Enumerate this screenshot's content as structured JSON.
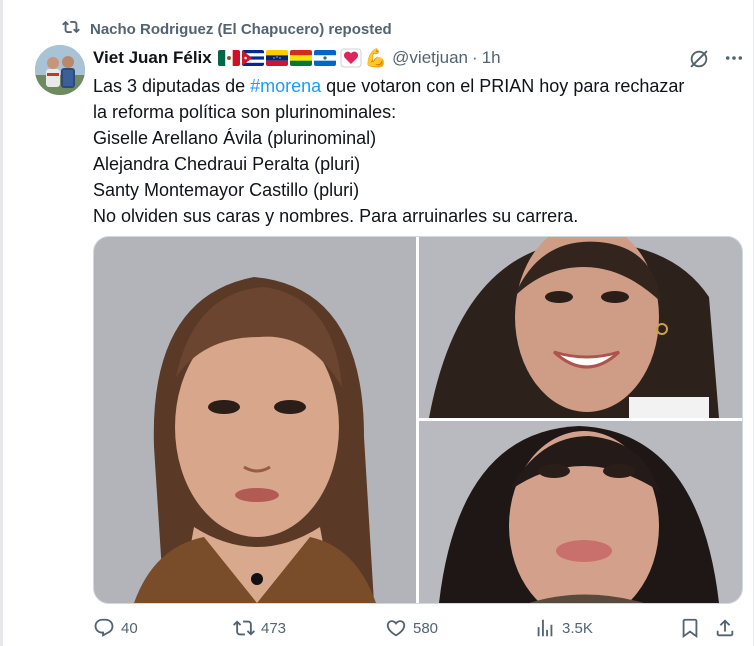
{
  "repost": {
    "icon": "repost-icon",
    "text": "Nacho Rodriguez (El Chapucero) reposted"
  },
  "tweet": {
    "author_name": "Viet Juan Félix",
    "flags": [
      "mexico-flag",
      "cuba-flag",
      "venezuela-flag",
      "bolivia-flag",
      "nicaragua-flag",
      "heart",
      "flexed-biceps"
    ],
    "handle": "@vietjuan",
    "separator": "·",
    "time": "1h",
    "text": {
      "line1_before": "Las 3 diputadas de ",
      "line1_hashtag": "#morena",
      "line1_after": " que votaron con el PRIAN  hoy para rechazar",
      "line2": "la reforma política son plurinominales:",
      "line3": "Giselle Arellano Ávila  (plurinominal)",
      "line4": "Alejandra Chedraui Peralta (pluri)",
      "line5": "Santy Montemayor Castillo (pluri)",
      "line6": "No olviden sus caras y nombres. Para arruinarles su carrera."
    },
    "media": [
      {
        "name": "photo-1",
        "subject": "woman with long hair, gray background"
      },
      {
        "name": "photo-2",
        "subject": "smiling woman, gray background"
      },
      {
        "name": "photo-3",
        "subject": "woman with dark hair, gray background"
      }
    ]
  },
  "actions": {
    "reply_count": "40",
    "repost_count": "473",
    "like_count": "580",
    "views_count": "3.5K"
  },
  "colors": {
    "accent": "#1d9bf0",
    "muted": "#536471",
    "text": "#0f1419"
  }
}
